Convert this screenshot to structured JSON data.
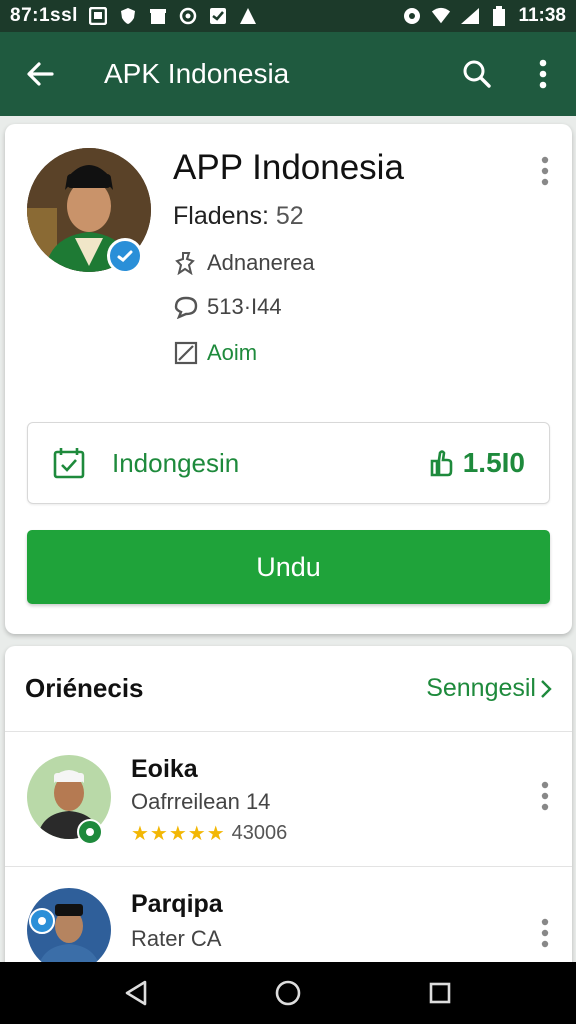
{
  "status_bar": {
    "left_text": "87:1ssl",
    "time": "11:38"
  },
  "app_bar": {
    "title": "APK Indonesia"
  },
  "profile": {
    "app_name": "APP Indonesia",
    "followers_label": "Fladens:",
    "followers_count": "52",
    "category": "Adnanerea",
    "downloads": "513·I44",
    "status": "Aoim",
    "badge_label": "Indongesin",
    "badge_count": "1.5I0",
    "download_button": "Undu"
  },
  "section": {
    "title": "Oriénecis",
    "link": "Senngesil"
  },
  "items": [
    {
      "name": "Eoika",
      "subtitle": "Oafrreilean 14",
      "stars": "★★★★★",
      "rating_count": "43006"
    },
    {
      "name": "Parqipa",
      "subtitle": "Rater CA"
    }
  ],
  "colors": {
    "accent_green": "#1fa33a",
    "appbar": "#1f5a3f",
    "statusbar": "#1c3a2a",
    "link_green": "#1e8a3c",
    "star": "#f2b705"
  }
}
